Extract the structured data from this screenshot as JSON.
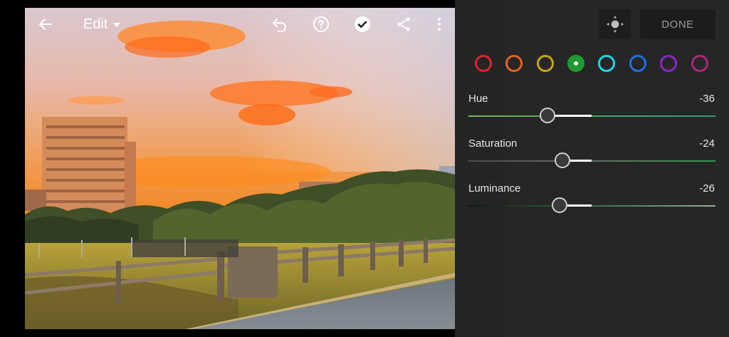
{
  "toolbar": {
    "edit_label": "Edit",
    "icons": [
      "back-arrow-icon",
      "undo-icon",
      "help-icon",
      "checkmark-icon",
      "share-icon",
      "more-vertical-icon"
    ]
  },
  "panel": {
    "target_icon": "target-adjustment-icon",
    "done_label": "DONE",
    "swatches": [
      {
        "name": "red",
        "color": "#e0202a"
      },
      {
        "name": "orange",
        "color": "#e2631e"
      },
      {
        "name": "yellow",
        "color": "#c9a414"
      },
      {
        "name": "green",
        "color": "#1f9b2f",
        "selected": true
      },
      {
        "name": "aqua",
        "color": "#1cd7e8"
      },
      {
        "name": "blue",
        "color": "#1f6fe6"
      },
      {
        "name": "purple",
        "color": "#8a26c9"
      },
      {
        "name": "magenta",
        "color": "#b0247d"
      }
    ],
    "sliders": [
      {
        "label": "Hue",
        "value": "-36",
        "fraction": 0.32
      },
      {
        "label": "Saturation",
        "value": "-24",
        "fraction": 0.38
      },
      {
        "label": "Luminance",
        "value": "-26",
        "fraction": 0.37
      }
    ]
  }
}
